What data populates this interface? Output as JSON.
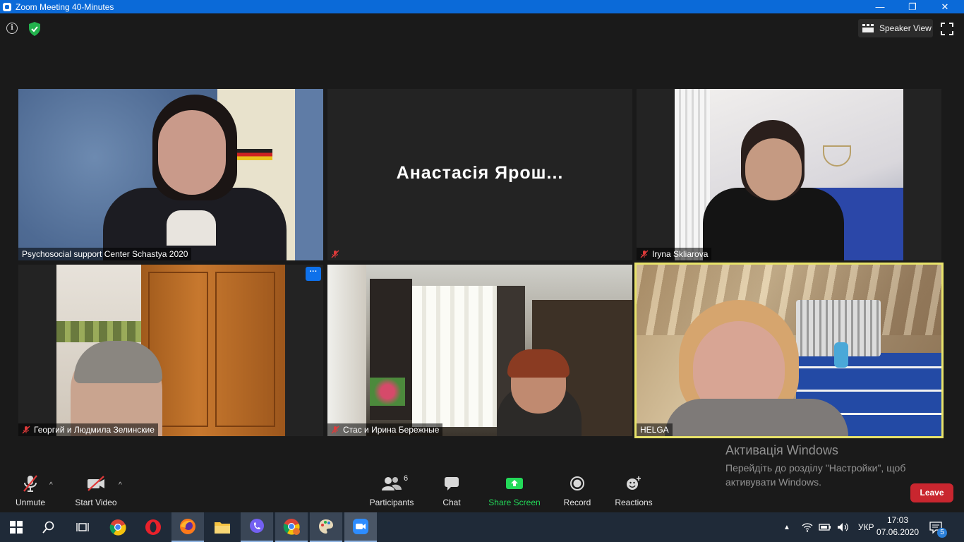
{
  "window": {
    "title": "Zoom Meeting 40-Minutes",
    "minimize": "—",
    "restore": "❐",
    "close": "✕"
  },
  "header": {
    "view_button_label": "Speaker View"
  },
  "tiles": [
    {
      "name": "Psychosocial support Center Schastya 2020",
      "muted": false
    },
    {
      "name": "",
      "display_name": "Анастасія Ярош...",
      "muted": true
    },
    {
      "name": "Iryna Skliarova",
      "muted": true
    },
    {
      "name": "Георгий и Людмила Зелинские",
      "muted": true
    },
    {
      "name": "Стас и Ирина Бережные",
      "muted": true
    },
    {
      "name": "HELGA",
      "muted": false,
      "active_speaker": true
    }
  ],
  "tile_menu_label": "···",
  "activation": {
    "title": "Активація Windows",
    "line1": "Перейдіть до розділу \"Настройки\", щоб",
    "line2": "активувати Windows."
  },
  "controls": {
    "unmute": "Unmute",
    "start_video": "Start Video",
    "participants": "Participants",
    "participants_count": "6",
    "chat": "Chat",
    "share_screen": "Share Screen",
    "record": "Record",
    "reactions": "Reactions",
    "leave": "Leave",
    "caret": "^"
  },
  "taskbar": {
    "language": "УКР",
    "time": "17:03",
    "date": "07.06.2020",
    "notification_count": "5"
  },
  "colors": {
    "zoom_blue": "#0b6ad8",
    "share_green": "#23d959",
    "leave_red": "#c9262f",
    "active_speaker_border": "#e8e36a",
    "muted_red": "#e03a3a"
  }
}
